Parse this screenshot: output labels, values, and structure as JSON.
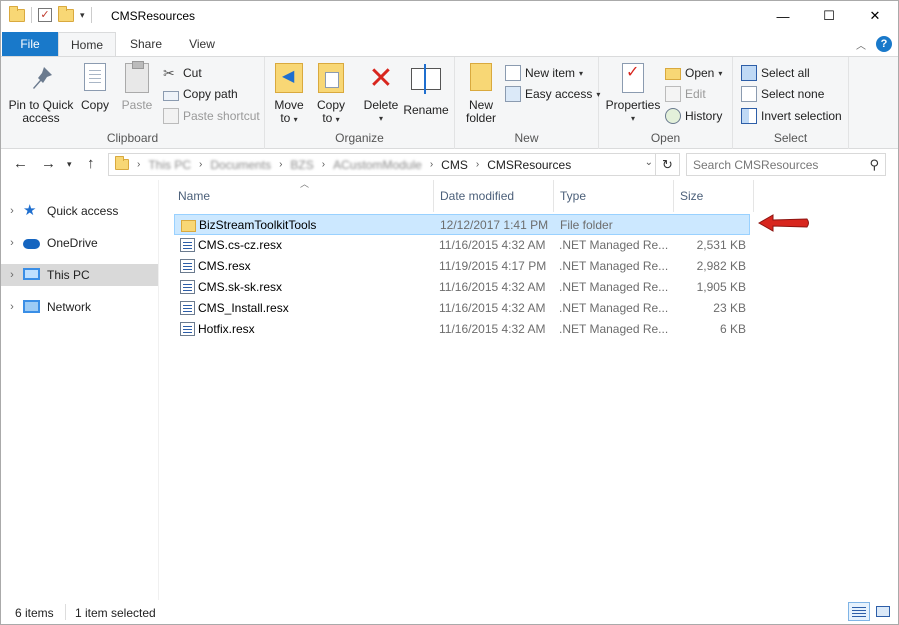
{
  "window": {
    "title": "CMSResources",
    "controls": {
      "minimize": "—",
      "maximize": "☐",
      "close": "✕"
    }
  },
  "ribbon_tabs": [
    {
      "label": "File"
    },
    {
      "label": "Home"
    },
    {
      "label": "Share"
    },
    {
      "label": "View"
    }
  ],
  "ribbon": {
    "clipboard": {
      "group_label": "Clipboard",
      "pin_line1": "Pin to Quick",
      "pin_line2": "access",
      "copy": "Copy",
      "paste": "Paste",
      "cut": "Cut",
      "copy_path": "Copy path",
      "paste_shortcut": "Paste shortcut"
    },
    "organize": {
      "group_label": "Organize",
      "move_line1": "Move",
      "move_line2": "to",
      "copy_line1": "Copy",
      "copy_line2": "to",
      "delete": "Delete",
      "rename": "Rename"
    },
    "new": {
      "group_label": "New",
      "new_folder_line1": "New",
      "new_folder_line2": "folder",
      "new_item": "New item",
      "easy_access": "Easy access"
    },
    "open": {
      "group_label": "Open",
      "properties": "Properties",
      "open": "Open",
      "edit": "Edit",
      "history": "History"
    },
    "select": {
      "group_label": "Select",
      "select_all": "Select all",
      "select_none": "Select none",
      "invert_selection": "Invert selection"
    }
  },
  "address": {
    "blurred_segments": [
      "This PC",
      "Documents",
      "BZS",
      "ACustomModule"
    ],
    "segments": [
      "CMS",
      "CMSResources"
    ],
    "search_placeholder": "Search CMSResources"
  },
  "nav_pane": [
    {
      "label": "Quick access",
      "icon": "star-icon"
    },
    {
      "label": "OneDrive",
      "icon": "cloud-icon"
    },
    {
      "label": "This PC",
      "icon": "computer-icon",
      "selected": true
    },
    {
      "label": "Network",
      "icon": "network-icon"
    }
  ],
  "columns": {
    "name": "Name",
    "date": "Date modified",
    "type": "Type",
    "size": "Size"
  },
  "files": [
    {
      "name": "BizStreamToolkitTools",
      "date": "12/12/2017 1:41 PM",
      "type": "File folder",
      "size": "",
      "kind": "folder",
      "selected": true
    },
    {
      "name": "CMS.cs-cz.resx",
      "date": "11/16/2015 4:32 AM",
      "type": ".NET Managed Re...",
      "size": "2,531 KB",
      "kind": "resx"
    },
    {
      "name": "CMS.resx",
      "date": "11/19/2015 4:17 PM",
      "type": ".NET Managed Re...",
      "size": "2,982 KB",
      "kind": "resx"
    },
    {
      "name": "CMS.sk-sk.resx",
      "date": "11/16/2015 4:32 AM",
      "type": ".NET Managed Re...",
      "size": "1,905 KB",
      "kind": "resx"
    },
    {
      "name": "CMS_Install.resx",
      "date": "11/16/2015 4:32 AM",
      "type": ".NET Managed Re...",
      "size": "23 KB",
      "kind": "resx"
    },
    {
      "name": "Hotfix.resx",
      "date": "11/16/2015 4:32 AM",
      "type": ".NET Managed Re...",
      "size": "6 KB",
      "kind": "resx"
    }
  ],
  "status": {
    "item_count": "6 items",
    "selection": "1 item selected"
  },
  "colors": {
    "file_tab": "#1979ca",
    "selection": "#cce8ff",
    "annotation_arrow": "#d8261e"
  }
}
